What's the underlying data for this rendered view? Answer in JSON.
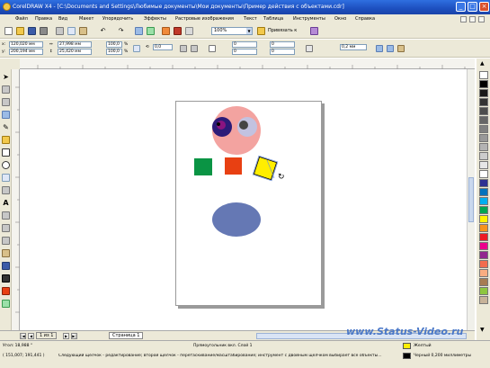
{
  "window": {
    "title": "CorelDRAW X4 - [C:\\Documents and Settings\\Любимые документы\\Мои документы\\Пример действия с объектами.cdr]",
    "buttons": [
      "_",
      "□",
      "×"
    ]
  },
  "menubar": {
    "items": [
      "Файл",
      "Правка",
      "Вид",
      "Макет",
      "Упорядочить",
      "Эффекты",
      "Растровые изображения",
      "Текст",
      "Таблица",
      "Инструменты",
      "Окно",
      "Справка"
    ]
  },
  "toolbar": {
    "zoom": "100%",
    "snap": "Привязать к"
  },
  "propbar": {
    "x": "120,020 мм",
    "y": "200,194 мм",
    "width": "27,998 мм",
    "height": "25,420 мм",
    "scale_x": "100,0",
    "scale_y": "100,0",
    "percent": "%",
    "angle": "0,0",
    "nudge_1": "0",
    "nudge_2": "0",
    "nudge_3": "0",
    "nudge_4": "0",
    "outline": "0,2 мм"
  },
  "pages": {
    "counter": "1 из 1",
    "current_tab": "Страница 1"
  },
  "watermark": "www.Status-Video.ru",
  "status": {
    "coords": "Угол: 18,988 °",
    "mouse_pos": "( 151,007; 191,441 )",
    "hint": "Следующий щелчок - редактирование; второй щелчок - перетаскивание/масштабирование; инструмент с двойным щелчком выбирает все объекты...",
    "object_info": "Прямоугольник вкл. Слой 1",
    "fill_label": "Желтый",
    "outline_label": "Черный  0,200 миллиметры"
  },
  "colors": {
    "accent_green": "#0a9444",
    "accent_red": "#e84012",
    "yellow": "#ffee00",
    "salmon": "#f3a3a0",
    "ellipse_blue": "#6578b4"
  }
}
